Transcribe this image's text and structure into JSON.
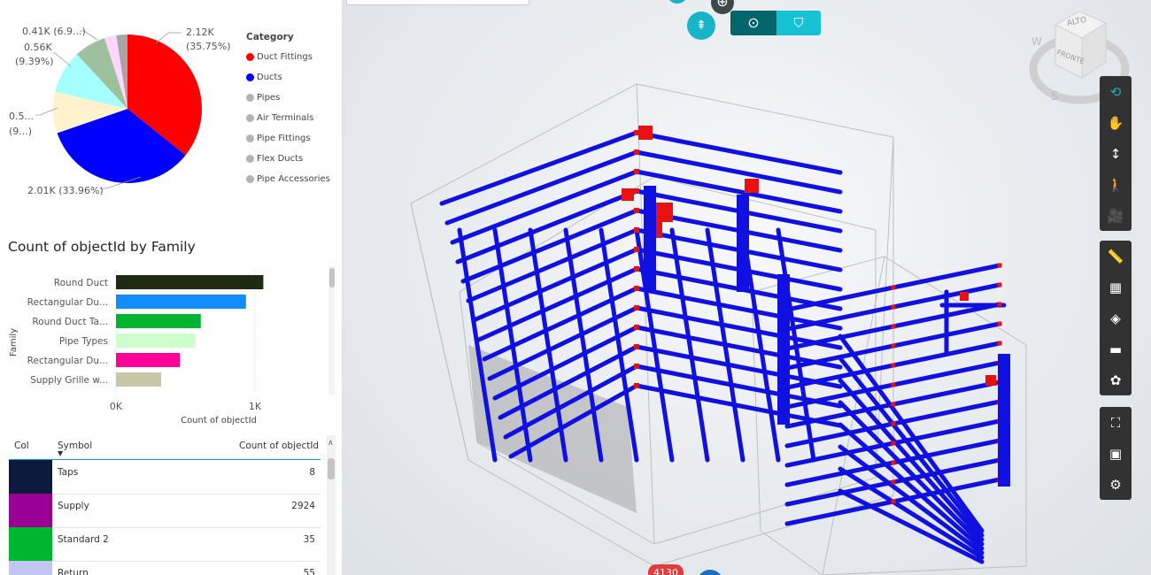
{
  "pie": {
    "labels": [
      {
        "value": "2.12K",
        "pct": "(35.75%)"
      },
      {
        "value": "2.01K (33.96%)",
        "pct": ""
      },
      {
        "value": "0.5...",
        "pct": "(9...)"
      },
      {
        "value": "0.56K",
        "pct": "(9.39%)"
      },
      {
        "value": "0.41K (6.9...)",
        "pct": ""
      }
    ],
    "colors": [
      "#ff0000",
      "#0000ff",
      "#fff2cc",
      "#a6ffff",
      "#9dc09d",
      "#ffd6ff",
      "#a6a6a6"
    ]
  },
  "legend": {
    "title": "Category",
    "items": [
      {
        "label": "Duct Fittings",
        "color": "#ff0000"
      },
      {
        "label": "Ducts",
        "color": "#0000ff"
      },
      {
        "label": "Pipes",
        "color": "#b3b3b3"
      },
      {
        "label": "Air Terminals",
        "color": "#b3b3b3"
      },
      {
        "label": "Pipe Fittings",
        "color": "#b3b3b3"
      },
      {
        "label": "Flex Ducts",
        "color": "#b3b3b3"
      },
      {
        "label": "Pipe Accessories",
        "color": "#b3b3b3"
      }
    ]
  },
  "bar": {
    "title": "Count of objectId by Family",
    "ylabel": "Family",
    "xlabel": "Count of objectId",
    "ticks": [
      "0K",
      "1K"
    ]
  },
  "chart_data": {
    "type": "bar",
    "orientation": "horizontal",
    "title": "Count of objectId by Family",
    "categories": [
      "Round Duct",
      "Rectangular Du...",
      "Round Duct Ta...",
      "Pipe Types",
      "Rectangular Du...",
      "Supply Grille w..."
    ],
    "values": [
      1060,
      935,
      610,
      570,
      460,
      325
    ],
    "colors": [
      "#202a12",
      "#118dff",
      "#00b52f",
      "#ccffcc",
      "#ff0099",
      "#c8c8a8"
    ],
    "xlabel": "Count of objectId",
    "ylabel": "Family",
    "xlim": [
      0,
      1200
    ],
    "legend": "none"
  },
  "table": {
    "headers": {
      "col": "Col",
      "symbol": "Symbol",
      "count": "Count of objectId"
    },
    "rows": [
      {
        "color": "#0b1a3d",
        "symbol": "Taps",
        "count": "8"
      },
      {
        "color": "#9b0094",
        "symbol": "Supply",
        "count": "2924"
      },
      {
        "color": "#00b52f",
        "symbol": "Standard 2",
        "count": "35"
      },
      {
        "color": "#c0c6f0",
        "symbol": "Return",
        "count": "55"
      }
    ]
  },
  "viewer": {
    "cube_top": "ALTO",
    "cube_front": "FRONTE",
    "compass_w": "W",
    "compass_s": "S",
    "badge": "4130",
    "tools": [
      {
        "name": "orbit-icon",
        "glyph": "⟲"
      },
      {
        "name": "pan-hand-icon",
        "glyph": "✋"
      },
      {
        "name": "zoom-icon",
        "glyph": "↕"
      },
      {
        "name": "walk-person-icon",
        "glyph": "🚶"
      },
      {
        "name": "camera-icon",
        "glyph": "🎥"
      },
      {
        "name": "measure-icon",
        "glyph": "📏"
      },
      {
        "name": "section-box-icon",
        "glyph": "▦"
      },
      {
        "name": "explode-model-icon",
        "glyph": "◈"
      },
      {
        "name": "folder-icon",
        "glyph": "▬"
      },
      {
        "name": "components-icon",
        "glyph": "✿"
      },
      {
        "name": "model-tree-icon",
        "glyph": "⛶"
      },
      {
        "name": "properties-icon",
        "glyph": "▣"
      },
      {
        "name": "settings-gear-icon",
        "glyph": "⚙"
      }
    ]
  }
}
